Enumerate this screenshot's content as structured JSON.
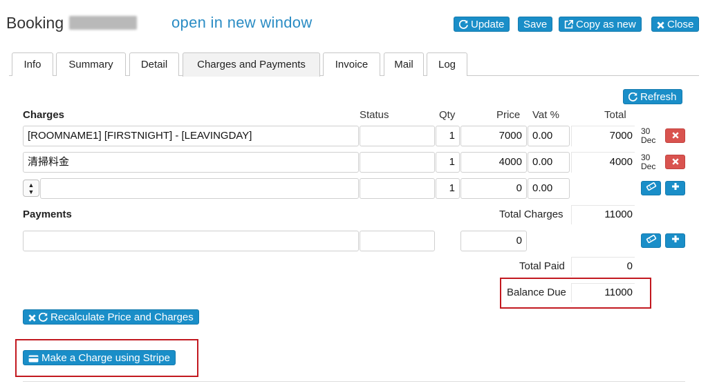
{
  "header": {
    "title": "Booking",
    "open_link": "open in new window",
    "buttons": {
      "update": "Update",
      "save": "Save",
      "copy": "Copy as new",
      "close": "Close"
    }
  },
  "tabs": [
    "Info",
    "Summary",
    "Detail",
    "Charges and Payments",
    "Invoice",
    "Mail",
    "Log"
  ],
  "active_tab": "Charges and Payments",
  "refresh_label": "Refresh",
  "charges": {
    "heading": "Charges",
    "columns": {
      "status": "Status",
      "qty": "Qty",
      "price": "Price",
      "vat": "Vat %",
      "total": "Total"
    },
    "rows": [
      {
        "description": "[ROOMNAME1] [FIRSTNIGHT] - [LEAVINGDAY]",
        "status": "",
        "qty": "1",
        "price": "7000",
        "vat": "0.00",
        "total": "7000",
        "date_day": "30",
        "date_month": "Dec"
      },
      {
        "description": "清掃料金",
        "status": "",
        "qty": "1",
        "price": "4000",
        "vat": "0.00",
        "total": "4000",
        "date_day": "30",
        "date_month": "Dec"
      }
    ],
    "new_row": {
      "description": "",
      "status": "",
      "qty": "1",
      "price": "0",
      "vat": "0.00"
    }
  },
  "payments": {
    "heading": "Payments",
    "total_charges_label": "Total Charges",
    "total_charges": "11000",
    "new_row": {
      "description": "",
      "status": "",
      "amount": "0"
    },
    "total_paid_label": "Total Paid",
    "total_paid": "0",
    "balance_due_label": "Balance Due",
    "balance_due": "11000"
  },
  "recalculate_label": "Recalculate Price and Charges",
  "stripe_label": "Make a Charge using Stripe",
  "colors": {
    "primary": "#1a8ec8",
    "danger": "#d9534f",
    "highlight": "#c2181f",
    "link": "#2a8cc4"
  }
}
